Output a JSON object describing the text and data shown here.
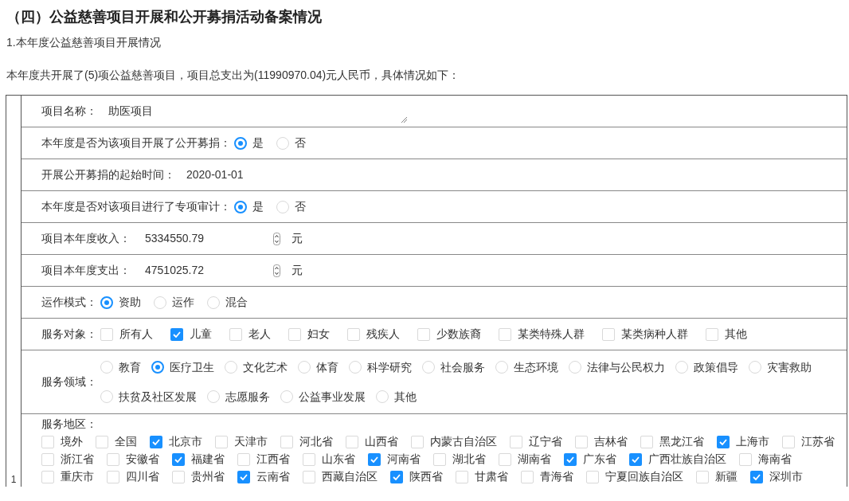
{
  "heading": "（四）公益慈善项目开展和公开募捐活动备案情况",
  "subheading": "1.本年度公益慈善项目开展情况",
  "summary": "本年度共开展了(5)项公益慈善项目，项目总支出为(11990970.04)元人民币，具体情况如下：",
  "project": {
    "index": "1",
    "fields": [
      {
        "kind": "textarea",
        "label": "项目名称：",
        "value": "助医项目"
      },
      {
        "kind": "radio",
        "label": "本年度是否为该项目开展了公开募捐：",
        "options": [
          {
            "label": "是",
            "selected": true
          },
          {
            "label": "否",
            "selected": false
          }
        ]
      },
      {
        "kind": "text",
        "label": "开展公开募捐的起始时间：",
        "value": "2020-01-01"
      },
      {
        "kind": "radio",
        "label": "本年度是否对该项目进行了专项审计：",
        "options": [
          {
            "label": "是",
            "selected": true
          },
          {
            "label": "否",
            "selected": false
          }
        ]
      },
      {
        "kind": "number",
        "label": "项目本年度收入：",
        "value": "5334550.79",
        "unit": "元"
      },
      {
        "kind": "number",
        "label": "项目本年度支出：",
        "value": "4751025.72",
        "unit": "元"
      },
      {
        "kind": "radio",
        "label": "运作模式：",
        "options": [
          {
            "label": "资助",
            "selected": true
          },
          {
            "label": "运作",
            "selected": false
          },
          {
            "label": "混合",
            "selected": false
          }
        ]
      },
      {
        "kind": "checkbox",
        "label": "服务对象：",
        "options": [
          {
            "label": "所有人",
            "checked": false
          },
          {
            "label": "儿童",
            "checked": true
          },
          {
            "label": "老人",
            "checked": false
          },
          {
            "label": "妇女",
            "checked": false
          },
          {
            "label": "残疾人",
            "checked": false
          },
          {
            "label": "少数族裔",
            "checked": false
          },
          {
            "label": "某类特殊人群",
            "checked": false
          },
          {
            "label": "某类病种人群",
            "checked": false
          },
          {
            "label": "其他",
            "checked": false
          }
        ]
      },
      {
        "kind": "radio_wrap",
        "label": "服务领域：",
        "options": [
          {
            "label": "教育",
            "selected": false
          },
          {
            "label": "医疗卫生",
            "selected": true
          },
          {
            "label": "文化艺术",
            "selected": false
          },
          {
            "label": "体育",
            "selected": false
          },
          {
            "label": "科学研究",
            "selected": false
          },
          {
            "label": "社会服务",
            "selected": false
          },
          {
            "label": "生态环境",
            "selected": false
          },
          {
            "label": "法律与公民权力",
            "selected": false
          },
          {
            "label": "政策倡导",
            "selected": false
          },
          {
            "label": "灾害救助",
            "selected": false
          },
          {
            "label": "扶贫及社区发展",
            "selected": false
          },
          {
            "label": "志愿服务",
            "selected": false
          },
          {
            "label": "公益事业发展",
            "selected": false
          },
          {
            "label": "其他",
            "selected": false
          }
        ]
      },
      {
        "kind": "region",
        "label": "服务地区：",
        "rows": [
          [
            {
              "label": "境外",
              "checked": false
            },
            {
              "label": "全国",
              "checked": false
            },
            {
              "label": "北京市",
              "checked": true
            },
            {
              "label": "天津市",
              "checked": false
            },
            {
              "label": "河北省",
              "checked": false
            },
            {
              "label": "山西省",
              "checked": false
            },
            {
              "label": "内蒙古自治区",
              "checked": false
            },
            {
              "label": "辽宁省",
              "checked": false
            },
            {
              "label": "吉林省",
              "checked": false
            },
            {
              "label": "黑龙江省",
              "checked": false
            },
            {
              "label": "上海市",
              "checked": true
            },
            {
              "label": "江苏省",
              "checked": false
            }
          ],
          [
            {
              "label": "浙江省",
              "checked": false
            },
            {
              "label": "安徽省",
              "checked": false
            },
            {
              "label": "福建省",
              "checked": true
            },
            {
              "label": "江西省",
              "checked": false
            },
            {
              "label": "山东省",
              "checked": false
            },
            {
              "label": "河南省",
              "checked": true
            },
            {
              "label": "湖北省",
              "checked": false
            },
            {
              "label": "湖南省",
              "checked": false
            },
            {
              "label": "广东省",
              "checked": true
            },
            {
              "label": "广西壮族自治区",
              "checked": true
            },
            {
              "label": "海南省",
              "checked": false
            }
          ],
          [
            {
              "label": "重庆市",
              "checked": false
            },
            {
              "label": "四川省",
              "checked": false
            },
            {
              "label": "贵州省",
              "checked": false
            },
            {
              "label": "云南省",
              "checked": true
            },
            {
              "label": "西藏自治区",
              "checked": false
            },
            {
              "label": "陕西省",
              "checked": true
            },
            {
              "label": "甘肃省",
              "checked": false
            },
            {
              "label": "青海省",
              "checked": false
            },
            {
              "label": "宁夏回族自治区",
              "checked": false
            },
            {
              "label": "新疆",
              "checked": false
            },
            {
              "label": "深圳市",
              "checked": true
            }
          ]
        ]
      }
    ]
  }
}
